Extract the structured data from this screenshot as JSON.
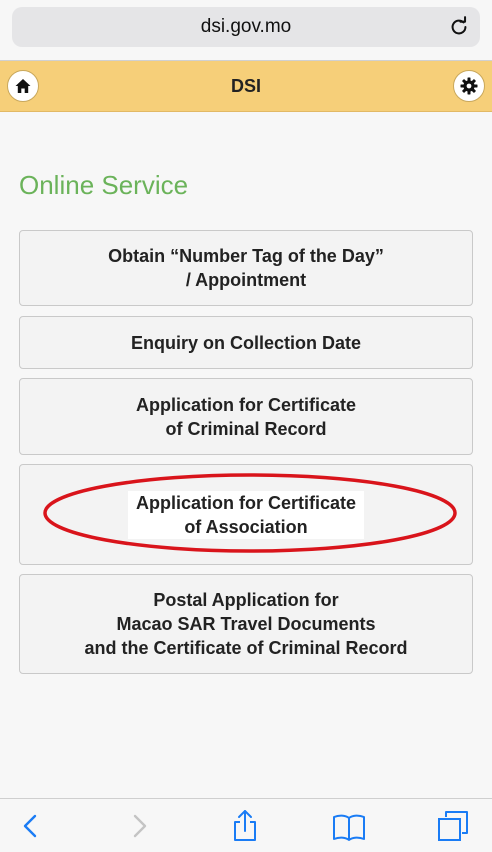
{
  "browser": {
    "url": "dsi.gov.mo"
  },
  "header": {
    "title": "DSI"
  },
  "main": {
    "section_title": "Online Service",
    "services": [
      {
        "label": "Obtain “Number Tag of the Day”\n/ Appointment"
      },
      {
        "label": "Enquiry on Collection Date"
      },
      {
        "label": "Application for Certificate\nof Criminal Record"
      },
      {
        "label": "Application for Certificate\nof Association",
        "highlighted": true
      },
      {
        "label": "Postal Application for\nMacao SAR Travel Documents\nand the Certificate of Criminal Record"
      }
    ]
  },
  "colors": {
    "header_bg": "#f6cf79",
    "section_title": "#6bb35a",
    "highlight_ring": "#d9141b",
    "toolbar_accent": "#1a7cf5"
  },
  "toolbar": {
    "icons": [
      "back-icon",
      "forward-icon",
      "share-icon",
      "bookmarks-icon",
      "tabs-icon"
    ]
  }
}
